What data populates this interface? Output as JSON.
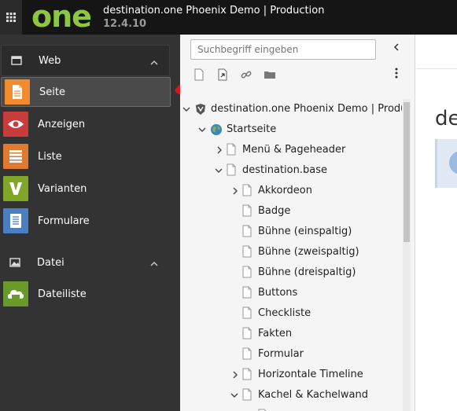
{
  "header": {
    "logo_text": "one",
    "site_title": "destination.one Phoenix Demo | Production",
    "version": "12.4.10"
  },
  "modules": {
    "groups": [
      {
        "label": "Web",
        "items": [
          {
            "label": "Seite",
            "color": "#f18b2d",
            "icon": "page-icon",
            "active": true
          },
          {
            "label": "Anzeigen",
            "color": "#c83c3c",
            "icon": "eye-icon"
          },
          {
            "label": "Liste",
            "color": "#e07a30",
            "icon": "list-icon"
          },
          {
            "label": "Varianten",
            "color": "#80a62a",
            "icon": "v-icon"
          },
          {
            "label": "Formulare",
            "color": "#4a7fc1",
            "icon": "form-icon"
          }
        ]
      },
      {
        "label": "Datei",
        "items": [
          {
            "label": "Dateiliste",
            "color": "#6a9a2c",
            "icon": "filelist-icon"
          }
        ]
      }
    ]
  },
  "nav": {
    "search_placeholder": "Suchbegriff eingeben",
    "tree": [
      {
        "label": "destination.one Phoenix Demo | Production",
        "level": 0,
        "expanded": true,
        "icon": "site-root-icon"
      },
      {
        "label": "Startseite",
        "level": 1,
        "expanded": true,
        "icon": "globe-icon"
      },
      {
        "label": "Menü & Pageheader",
        "level": 2,
        "expanded": false,
        "has_children": true
      },
      {
        "label": "destination.base",
        "level": 2,
        "expanded": true
      },
      {
        "label": "Akkordeon",
        "level": 3,
        "has_children": true,
        "expanded": false
      },
      {
        "label": "Badge",
        "level": 3
      },
      {
        "label": "Bühne (einspaltig)",
        "level": 3
      },
      {
        "label": "Bühne (zweispaltig)",
        "level": 3
      },
      {
        "label": "Bühne (dreispaltig)",
        "level": 3
      },
      {
        "label": "Buttons",
        "level": 3
      },
      {
        "label": "Checkliste",
        "level": 3
      },
      {
        "label": "Fakten",
        "level": 3
      },
      {
        "label": "Formular",
        "level": 3
      },
      {
        "label": "Horizontale Timeline",
        "level": 3,
        "has_children": true,
        "expanded": false
      },
      {
        "label": "Kachel & Kachelwand",
        "level": 3,
        "has_children": true,
        "expanded": true
      }
    ]
  },
  "content": {
    "title_fragment": "de"
  }
}
